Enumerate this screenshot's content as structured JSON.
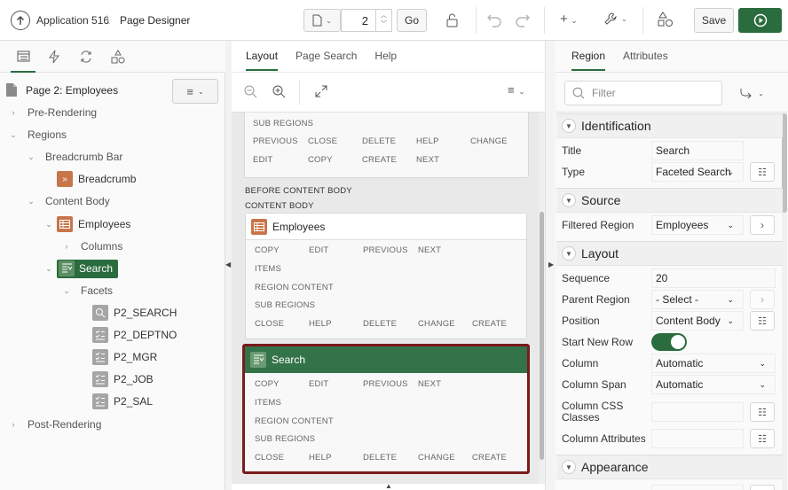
{
  "header": {
    "app_label": "Application 516",
    "separator": "\\",
    "page_designer": "Page Designer",
    "page_number": "2",
    "go_label": "Go",
    "save_label": "Save"
  },
  "left": {
    "tabs_icons": [
      "tree-icon",
      "lightning-icon",
      "sync-icon",
      "shapes-icon"
    ],
    "page_title": "Page 2: Employees",
    "tree": [
      {
        "label": "Pre-Rendering"
      },
      {
        "label": "Regions"
      },
      {
        "label": "Breadcrumb Bar"
      },
      {
        "label": "Breadcrumb"
      },
      {
        "label": "Content Body"
      },
      {
        "label": "Employees"
      },
      {
        "label": "Columns"
      },
      {
        "label": "Search"
      },
      {
        "label": "Facets"
      },
      {
        "label": "P2_SEARCH"
      },
      {
        "label": "P2_DEPTNO"
      },
      {
        "label": "P2_MGR"
      },
      {
        "label": "P2_JOB"
      },
      {
        "label": "P2_SAL"
      },
      {
        "label": "Post-Rendering"
      }
    ]
  },
  "center": {
    "tabs": [
      "Layout",
      "Page Search",
      "Help"
    ],
    "top_block": {
      "row1": [
        "SUB REGIONS"
      ],
      "row2": [
        "PREVIOUS",
        "CLOSE",
        "DELETE",
        "HELP",
        "CHANGE"
      ],
      "row3": [
        "EDIT",
        "COPY",
        "CREATE",
        "NEXT"
      ]
    },
    "before_content_body": "BEFORE CONTENT BODY",
    "content_body": "CONTENT BODY",
    "employees_card": {
      "title": "Employees",
      "row1": [
        "COPY",
        "EDIT",
        "PREVIOUS",
        "NEXT"
      ],
      "row2": [
        "ITEMS"
      ],
      "row3": [
        "REGION CONTENT"
      ],
      "row4": [
        "SUB REGIONS"
      ],
      "row5": [
        "CLOSE",
        "HELP",
        "DELETE",
        "CHANGE",
        "CREATE"
      ]
    },
    "search_card": {
      "title": "Search",
      "row1": [
        "COPY",
        "EDIT",
        "PREVIOUS",
        "NEXT"
      ],
      "row2": [
        "ITEMS"
      ],
      "row3": [
        "REGION CONTENT"
      ],
      "row4": [
        "SUB REGIONS"
      ],
      "row5": [
        "CLOSE",
        "HELP",
        "DELETE",
        "CHANGE",
        "CREATE"
      ]
    }
  },
  "right": {
    "tabs": [
      "Region",
      "Attributes"
    ],
    "filter_placeholder": "Filter",
    "sections": {
      "identification": "Identification",
      "source": "Source",
      "layout": "Layout",
      "appearance": "Appearance"
    },
    "props": {
      "title_label": "Title",
      "title_value": "Search",
      "type_label": "Type",
      "type_value": "Faceted Search",
      "filtered_label": "Filtered Region",
      "filtered_value": "Employees",
      "sequence_label": "Sequence",
      "sequence_value": "20",
      "parent_label": "Parent Region",
      "parent_value": "- Select -",
      "position_label": "Position",
      "position_value": "Content Body",
      "newrow_label": "Start New Row",
      "column_label": "Column",
      "column_value": "Automatic",
      "colspan_label": "Column Span",
      "colspan_value": "Automatic",
      "colcss_label": "Column CSS Classes",
      "colattr_label": "Column Attributes"
    },
    "start_new_row_on": true
  },
  "colors": {
    "accent_green": "#2a6c3e",
    "search_header": "#33734a",
    "selected_border": "#7a1b1b",
    "region_icon": "#c8754a"
  }
}
